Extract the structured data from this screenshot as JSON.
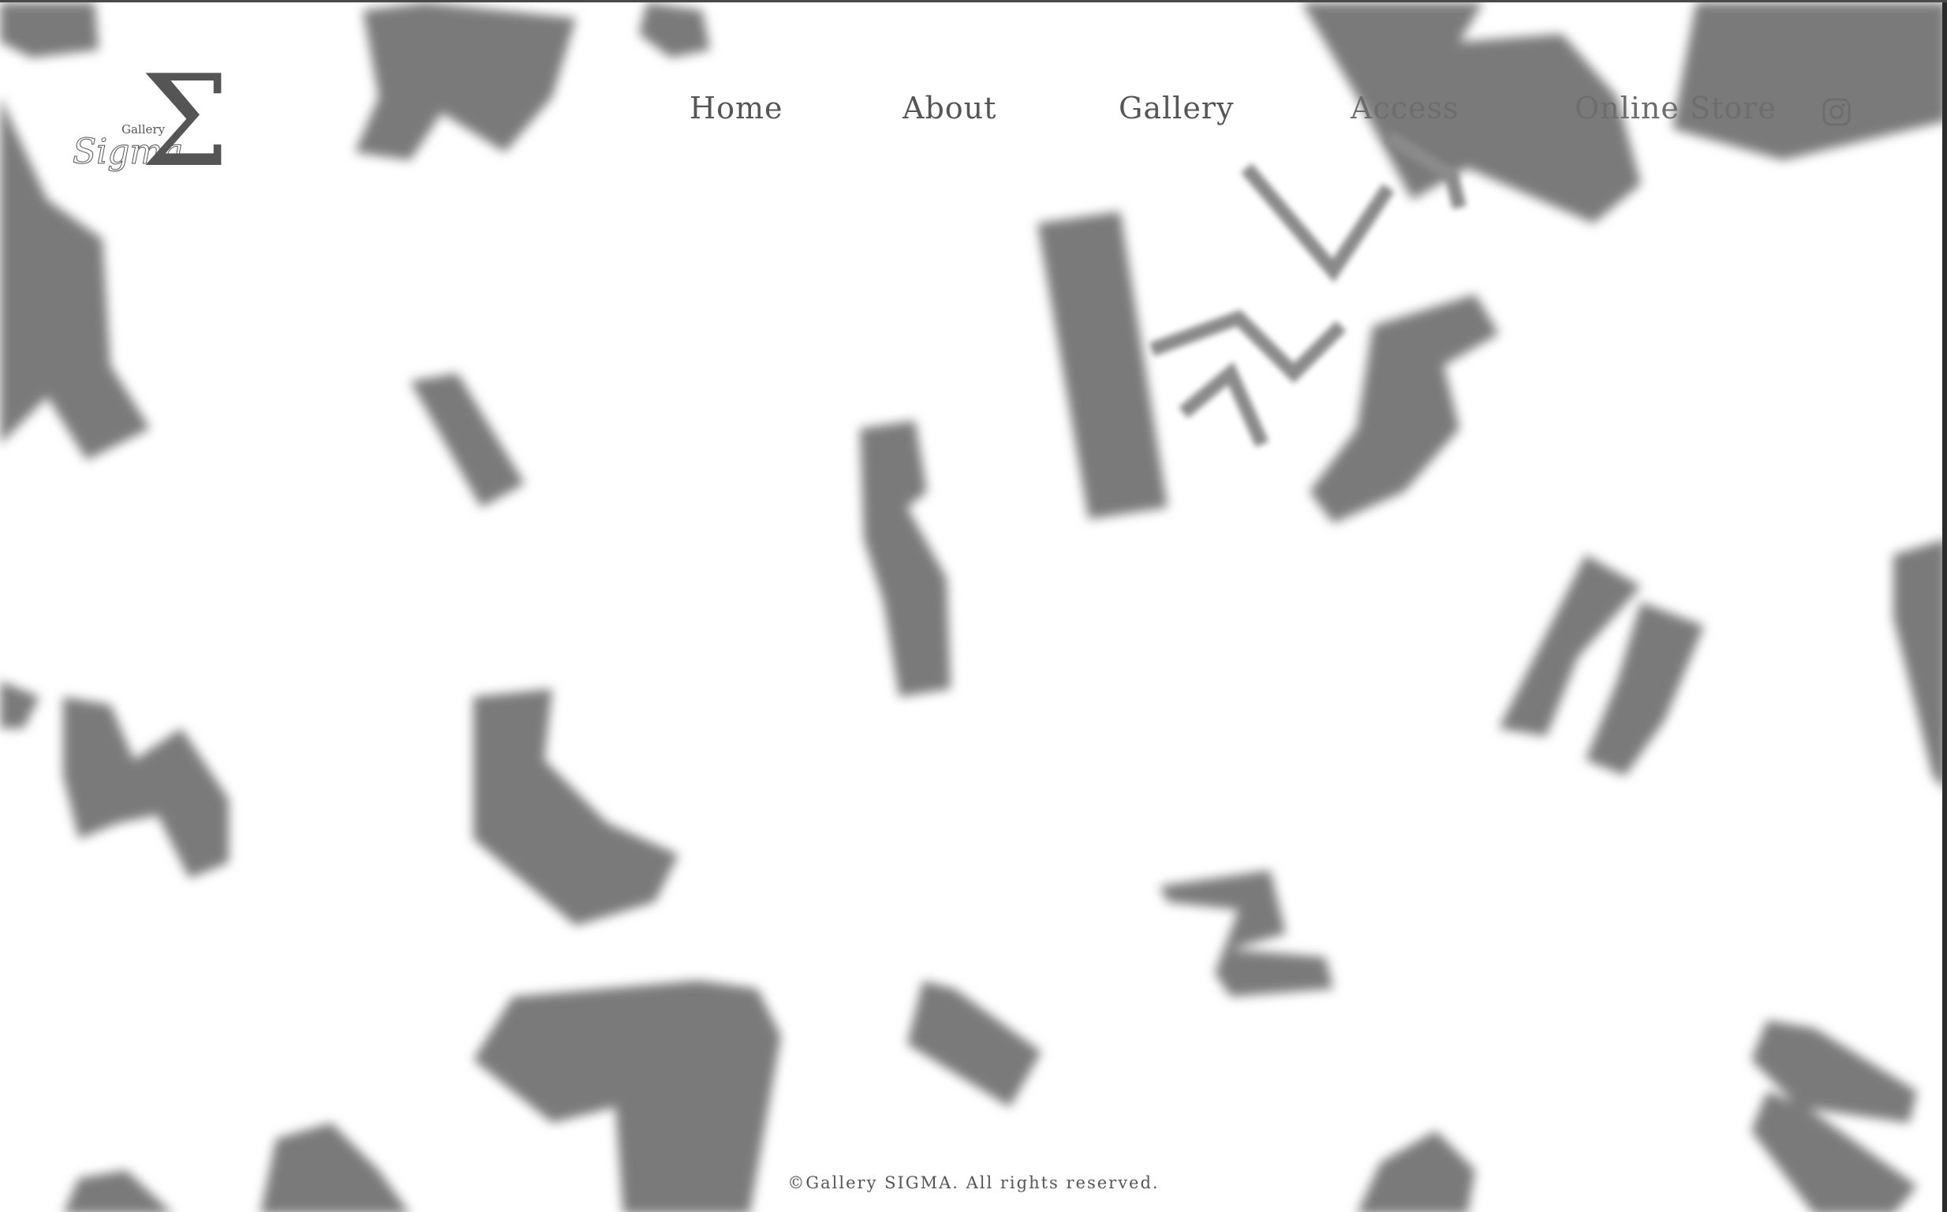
{
  "site": {
    "logo_word": "Gallery",
    "logo_script": "Sigma",
    "logo_symbol": "Σ"
  },
  "nav": {
    "items": [
      {
        "label": "Home"
      },
      {
        "label": "About"
      },
      {
        "label": "Gallery"
      },
      {
        "label": "Access"
      },
      {
        "label": "Online Store"
      }
    ],
    "social_icon": "instagram-icon"
  },
  "footer": {
    "copyright": "©Gallery SIGMA. All rights reserved."
  },
  "colors": {
    "background": "#ffffff",
    "shapes": "#7a7a7a",
    "text": "#555555"
  }
}
